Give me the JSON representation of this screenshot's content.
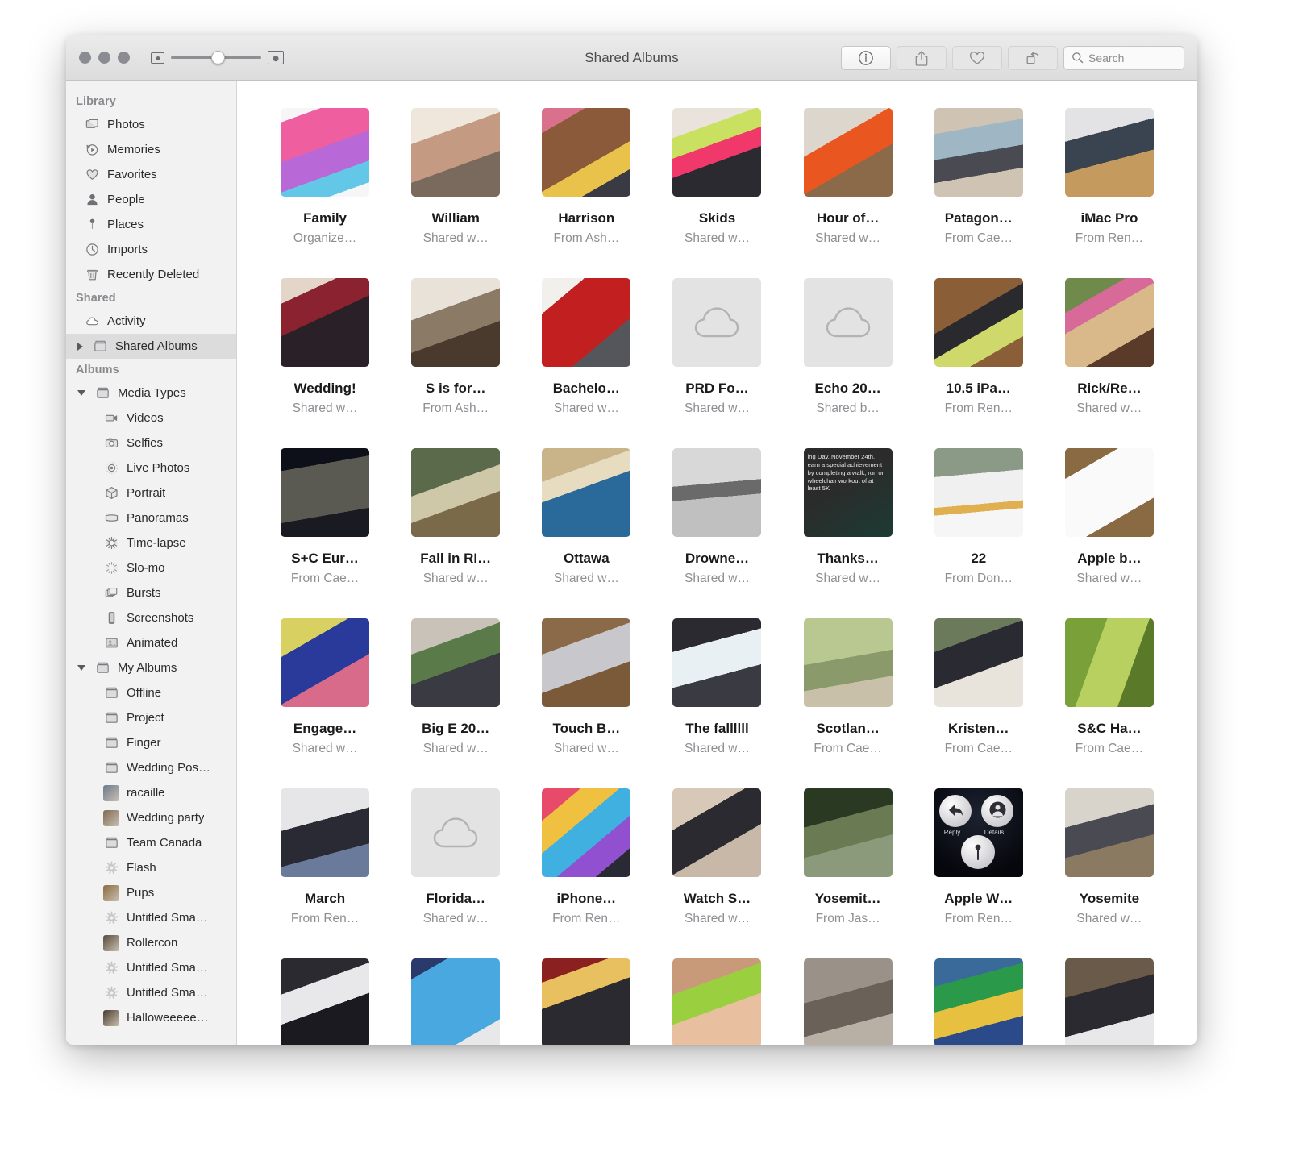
{
  "window": {
    "title": "Shared Albums"
  },
  "toolbar": {
    "info_label": "info-button",
    "share_label": "share-button",
    "favorite_label": "favorite-button",
    "rotate_label": "rotate-button",
    "search_placeholder": "Search",
    "search_value": "",
    "zoom_min_label": "small-thumbnails",
    "zoom_max_label": "large-thumbnails"
  },
  "sidebar": {
    "sections": [
      {
        "header": "Library",
        "items": [
          {
            "label": "Photos",
            "icon": "photos-icon",
            "selected": false
          },
          {
            "label": "Memories",
            "icon": "memories-icon",
            "selected": false
          },
          {
            "label": "Favorites",
            "icon": "heart-icon",
            "selected": false
          },
          {
            "label": "People",
            "icon": "person-icon",
            "selected": false
          },
          {
            "label": "Places",
            "icon": "pin-icon",
            "selected": false
          },
          {
            "label": "Imports",
            "icon": "clock-icon",
            "selected": false
          },
          {
            "label": "Recently Deleted",
            "icon": "trash-icon",
            "selected": false
          }
        ]
      },
      {
        "header": "Shared",
        "items": [
          {
            "label": "Activity",
            "icon": "cloud-icon",
            "selected": false
          },
          {
            "label": "Shared Albums",
            "icon": "album-icon",
            "selected": true,
            "disclosure": "right"
          }
        ]
      },
      {
        "header": "Albums",
        "items": [
          {
            "label": "Media Types",
            "icon": "album-icon",
            "selected": false,
            "disclosure": "down",
            "level": 1
          },
          {
            "label": "Videos",
            "icon": "video-icon",
            "selected": false,
            "level": 2
          },
          {
            "label": "Selfies",
            "icon": "camera-icon",
            "selected": false,
            "level": 2
          },
          {
            "label": "Live Photos",
            "icon": "live-icon",
            "selected": false,
            "level": 2
          },
          {
            "label": "Portrait",
            "icon": "cube-icon",
            "selected": false,
            "level": 2
          },
          {
            "label": "Panoramas",
            "icon": "panorama-icon",
            "selected": false,
            "level": 2
          },
          {
            "label": "Time-lapse",
            "icon": "timelapse-icon",
            "selected": false,
            "level": 2
          },
          {
            "label": "Slo-mo",
            "icon": "slomo-icon",
            "selected": false,
            "level": 2
          },
          {
            "label": "Bursts",
            "icon": "bursts-icon",
            "selected": false,
            "level": 2
          },
          {
            "label": "Screenshots",
            "icon": "phone-icon",
            "selected": false,
            "level": 2
          },
          {
            "label": "Animated",
            "icon": "animated-icon",
            "selected": false,
            "level": 2
          },
          {
            "label": "My Albums",
            "icon": "album-icon",
            "selected": false,
            "disclosure": "down",
            "level": 1
          },
          {
            "label": "Offline",
            "icon": "album-icon",
            "selected": false,
            "level": 2
          },
          {
            "label": "Project",
            "icon": "album-icon",
            "selected": false,
            "level": 2
          },
          {
            "label": "Finger",
            "icon": "album-icon",
            "selected": false,
            "level": 2
          },
          {
            "label": "Wedding Pos…",
            "icon": "album-icon",
            "selected": false,
            "level": 2
          },
          {
            "label": "racaille",
            "icon": "photo-thumb",
            "selected": false,
            "level": 2,
            "thumb": "#6c7a8c"
          },
          {
            "label": "Wedding party",
            "icon": "photo-thumb",
            "selected": false,
            "level": 2,
            "thumb": "#7d6a52"
          },
          {
            "label": "Team Canada",
            "icon": "album-icon",
            "selected": false,
            "level": 2
          },
          {
            "label": "Flash",
            "icon": "gear-icon",
            "selected": false,
            "level": 2
          },
          {
            "label": "Pups",
            "icon": "photo-thumb",
            "selected": false,
            "level": 2,
            "thumb": "#8a6b3f"
          },
          {
            "label": "Untitled Sma…",
            "icon": "gear-icon",
            "selected": false,
            "level": 2
          },
          {
            "label": "Rollercon",
            "icon": "photo-thumb",
            "selected": false,
            "level": 2,
            "thumb": "#5a4a3a"
          },
          {
            "label": "Untitled Sma…",
            "icon": "gear-icon",
            "selected": false,
            "level": 2
          },
          {
            "label": "Untitled Sma…",
            "icon": "gear-icon",
            "selected": false,
            "level": 2
          },
          {
            "label": "Halloweeeee…",
            "icon": "photo-thumb",
            "selected": false,
            "level": 2,
            "thumb": "#4a3b2d"
          }
        ]
      }
    ]
  },
  "grid": {
    "albums": [
      {
        "name": "Family",
        "subtitle": "Organize…",
        "thumb": "apple-music"
      },
      {
        "name": "William",
        "subtitle": "Shared w…",
        "thumb": "mom-baby"
      },
      {
        "name": "Harrison",
        "subtitle": "From Ash…",
        "thumb": "baby-toy"
      },
      {
        "name": "Skids",
        "subtitle": "Shared w…",
        "thumb": "woman-pink"
      },
      {
        "name": "Hour of…",
        "subtitle": "Shared w…",
        "thumb": "phone-mug"
      },
      {
        "name": "Patagon…",
        "subtitle": "From Cae…",
        "thumb": "hotel-window"
      },
      {
        "name": "iMac Pro",
        "subtitle": "From Ren…",
        "thumb": "imac-desk"
      },
      {
        "name": "Wedding!",
        "subtitle": "Shared w…",
        "thumb": "wedding-room"
      },
      {
        "name": "S is for…",
        "subtitle": "From Ash…",
        "thumb": "hallway-two"
      },
      {
        "name": "Bachelo…",
        "subtitle": "Shared w…",
        "thumb": "red-mural"
      },
      {
        "name": "PRD Fo…",
        "subtitle": "Shared w…",
        "thumb": "cloud-placeholder"
      },
      {
        "name": "Echo 20…",
        "subtitle": "Shared b…",
        "thumb": "cloud-placeholder"
      },
      {
        "name": "10.5 iPa…",
        "subtitle": "From Ren…",
        "thumb": "bowl-wood"
      },
      {
        "name": "Rick/Re…",
        "subtitle": "Shared w…",
        "thumb": "latte-flowers"
      },
      {
        "name": "S+C Eur…",
        "subtitle": "From Cae…",
        "thumb": "night-building"
      },
      {
        "name": "Fall in RI…",
        "subtitle": "Shared w…",
        "thumb": "grass-kid"
      },
      {
        "name": "Ottawa",
        "subtitle": "Shared w…",
        "thumb": "kid-hat"
      },
      {
        "name": "Drowne…",
        "subtitle": "Shared w…",
        "thumb": "bw-pool"
      },
      {
        "name": "Thanks…",
        "subtitle": "Shared w…",
        "thumb": "watch-note",
        "note": "ing Day, November 24th, earn a special achievement by completing a walk, run or wheelchair workout of at least 5K"
      },
      {
        "name": "22",
        "subtitle": "From Don…",
        "thumb": "skater"
      },
      {
        "name": "Apple b…",
        "subtitle": "Shared w…",
        "thumb": "envelope-wood"
      },
      {
        "name": "Engage…",
        "subtitle": "Shared w…",
        "thumb": "bike-blue"
      },
      {
        "name": "Big E 20…",
        "subtitle": "Shared w…",
        "thumb": "fair-woman"
      },
      {
        "name": "Touch B…",
        "subtitle": "Shared w…",
        "thumb": "laptop-wood"
      },
      {
        "name": "The fallllll",
        "subtitle": "Shared w…",
        "thumb": "water-rocks"
      },
      {
        "name": "Scotlan…",
        "subtitle": "From Cae…",
        "thumb": "green-hill"
      },
      {
        "name": "Kristen…",
        "subtitle": "From Cae…",
        "thumb": "outdoor-wedding"
      },
      {
        "name": "S&C Ha…",
        "subtitle": "From Cae…",
        "thumb": "green-grass"
      },
      {
        "name": "March",
        "subtitle": "From Ren…",
        "thumb": "person-bag"
      },
      {
        "name": "Florida…",
        "subtitle": "Shared w…",
        "thumb": "cloud-placeholder"
      },
      {
        "name": "iPhone…",
        "subtitle": "From Ren…",
        "thumb": "blur-colors"
      },
      {
        "name": "Watch S…",
        "subtitle": "Shared w…",
        "thumb": "wrist-watch"
      },
      {
        "name": "Yosemit…",
        "subtitle": "From Jas…",
        "thumb": "forest-crowd"
      },
      {
        "name": "Apple W…",
        "subtitle": "From Ren…",
        "thumb": "watch-reply",
        "watch": {
          "reply": "Reply",
          "details": "Details"
        }
      },
      {
        "name": "Yosemite",
        "subtitle": "Shared w…",
        "thumb": "conference"
      },
      {
        "name": "",
        "subtitle": "",
        "thumb": "watch-band"
      },
      {
        "name": "",
        "subtitle": "",
        "thumb": "disneyland-ticket"
      },
      {
        "name": "",
        "subtitle": "",
        "thumb": "party-hats"
      },
      {
        "name": "",
        "subtitle": "",
        "thumb": "woman-bottle"
      },
      {
        "name": "",
        "subtitle": "",
        "thumb": "ruins-stone"
      },
      {
        "name": "",
        "subtitle": "",
        "thumb": "roller-derby"
      },
      {
        "name": "",
        "subtitle": "",
        "thumb": "skate-legs"
      }
    ]
  }
}
